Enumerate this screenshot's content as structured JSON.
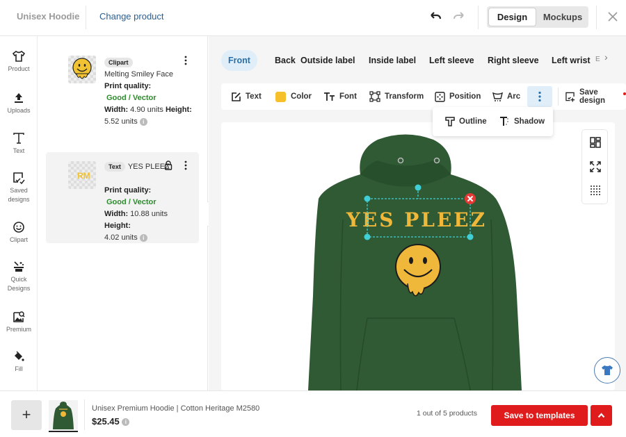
{
  "header": {
    "product_name": "Unisex Hoodie",
    "change_product": "Change product",
    "mode_tabs": [
      {
        "label": "Design",
        "active": true
      },
      {
        "label": "Mockups",
        "active": false
      }
    ]
  },
  "sidebar": {
    "items": [
      {
        "label": "Product",
        "icon": "tshirt-icon"
      },
      {
        "label": "Uploads",
        "icon": "upload-icon"
      },
      {
        "label": "Text",
        "icon": "text-icon"
      },
      {
        "label": "Saved designs",
        "icon": "saved-designs-icon"
      },
      {
        "label": "Clipart",
        "icon": "smiley-icon"
      },
      {
        "label": "Quick Designs",
        "icon": "magic-wand-icon"
      },
      {
        "label": "Premium",
        "icon": "premium-image-icon"
      },
      {
        "label": "Fill",
        "icon": "paint-bucket-icon"
      }
    ]
  },
  "layers": [
    {
      "chip": "Clipart",
      "name": "Melting Smiley Face",
      "print_quality_label": "Print quality:",
      "print_quality": "Good / Vector",
      "width_label": "Width:",
      "width": "4.90 units",
      "height_label": "Height:",
      "height": "5.52 units",
      "selected": false
    },
    {
      "chip": "Text",
      "name": "YES PLEEZ",
      "print_quality_label": "Print quality:",
      "print_quality": "Good / Vector",
      "width_label": "Width:",
      "width": "10.88 units",
      "height_label": "Height:",
      "height": "4.02 units",
      "selected": true
    }
  ],
  "placement_tabs": [
    {
      "label": "Front",
      "active": true
    },
    {
      "label": "Back"
    },
    {
      "label": "Outside label"
    },
    {
      "label": "Inside label"
    },
    {
      "label": "Left sleeve"
    },
    {
      "label": "Right sleeve"
    },
    {
      "label": "Left wrist"
    }
  ],
  "placement_tab_badge": "E",
  "toolbar": {
    "text": "Text",
    "color": "Color",
    "color_value": "#f5c02a",
    "font": "Font",
    "transform": "Transform",
    "position": "Position",
    "arc": "Arc",
    "save_design": "Save design"
  },
  "more_menu": {
    "outline": "Outline",
    "shadow": "Shadow"
  },
  "design": {
    "text": "YES PLEEZ",
    "text_color": "#f0b83a",
    "hoodie_color": "#2f5a34"
  },
  "bottom": {
    "product_title": "Unisex Premium Hoodie | Cotton Heritage M2580",
    "price": "$25.45",
    "count": "1 out of 5 products",
    "save_templates": "Save to templates"
  },
  "colors": {
    "accent": "#2a6fa8",
    "danger": "#e01b1b",
    "good": "#2e8b2e"
  }
}
